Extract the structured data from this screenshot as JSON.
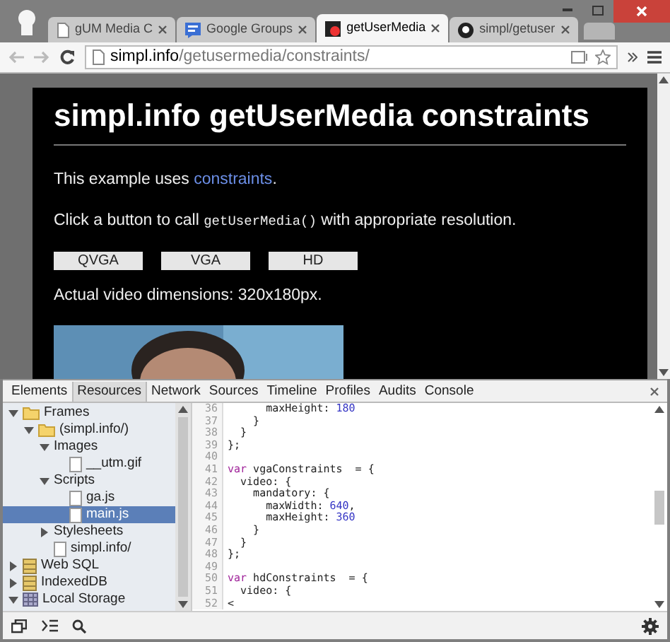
{
  "browser": {
    "tabs": [
      {
        "title": "gUM Media C",
        "kind": "page",
        "selected": false
      },
      {
        "title": "Google Groups",
        "kind": "groups",
        "selected": false
      },
      {
        "title": "getUserMedia",
        "kind": "record",
        "selected": true
      },
      {
        "title": "simpl/getuser",
        "kind": "github",
        "selected": false
      }
    ],
    "url_host": "simpl.info",
    "url_path": "/getusermedia/constraints/"
  },
  "page": {
    "heading": "simpl.info getUserMedia constraints",
    "intro_prefix": "This example uses ",
    "intro_link": "constraints",
    "intro_suffix": ".",
    "instruction_prefix": "Click a button to call ",
    "instruction_code": "getUserMedia()",
    "instruction_suffix": " with appropriate resolution.",
    "buttons": [
      "QVGA",
      "VGA",
      "HD"
    ],
    "dimensions": "Actual video dimensions: 320x180px.",
    "video": {
      "kind": "picture"
    }
  },
  "devtools": {
    "tabs": [
      {
        "label": "Elements",
        "selected": false
      },
      {
        "label": "Resources",
        "selected": true
      },
      {
        "label": "Network",
        "selected": false
      },
      {
        "label": "Sources",
        "selected": false
      },
      {
        "label": "Timeline",
        "selected": false
      },
      {
        "label": "Profiles",
        "selected": false
      },
      {
        "label": "Audits",
        "selected": false
      },
      {
        "label": "Console",
        "selected": false
      }
    ],
    "tree": [
      {
        "label": "Frames",
        "kind": "folder",
        "expanded": true,
        "selected": false,
        "children": [
          {
            "label": "(simpl.info/)",
            "kind": "folder",
            "expanded": true,
            "selected": false,
            "children": [
              {
                "label": "Images",
                "expanded": true,
                "selected": false,
                "children": [
                  {
                    "label": "__utm.gif",
                    "kind": "file",
                    "selected": false
                  }
                ]
              },
              {
                "label": "Scripts",
                "expanded": true,
                "selected": false,
                "children": [
                  {
                    "label": "ga.js",
                    "kind": "file",
                    "selected": false
                  },
                  {
                    "label": "main.js",
                    "kind": "file",
                    "selected": true
                  }
                ]
              },
              {
                "label": "Stylesheets",
                "expanded": false,
                "selected": false
              },
              {
                "label": "simpl.info/",
                "kind": "file",
                "selected": false
              }
            ]
          }
        ]
      },
      {
        "label": "Web SQL",
        "kind": "db",
        "expanded": false,
        "selected": false
      },
      {
        "label": "IndexedDB",
        "kind": "db",
        "expanded": false,
        "selected": false
      },
      {
        "label": "Local Storage",
        "kind": "grid",
        "expanded": true,
        "selected": false
      }
    ],
    "code": [
      {
        "n": "36",
        "tokens": [
          {
            "text": "      maxHeight: ",
            "kind": "plain"
          },
          {
            "text": "180",
            "kind": "number"
          }
        ]
      },
      {
        "n": "37",
        "tokens": [
          {
            "text": "    }",
            "kind": "plain"
          }
        ]
      },
      {
        "n": "38",
        "tokens": [
          {
            "text": "  }",
            "kind": "plain"
          }
        ]
      },
      {
        "n": "39",
        "tokens": [
          {
            "text": "};",
            "kind": "plain"
          }
        ]
      },
      {
        "n": "40"
      },
      {
        "n": "41",
        "tokens": [
          {
            "text": "var",
            "kind": "keyword"
          },
          {
            "text": " vgaConstraints  = {",
            "kind": "plain"
          }
        ]
      },
      {
        "n": "42",
        "tokens": [
          {
            "text": "  video: {",
            "kind": "plain"
          }
        ]
      },
      {
        "n": "43",
        "tokens": [
          {
            "text": "    mandatory: {",
            "kind": "plain"
          }
        ]
      },
      {
        "n": "44",
        "tokens": [
          {
            "text": "      maxWidth: ",
            "kind": "plain"
          },
          {
            "text": "640",
            "kind": "number"
          },
          {
            "text": ",",
            "kind": "plain"
          }
        ]
      },
      {
        "n": "45",
        "tokens": [
          {
            "text": "      maxHeight: ",
            "kind": "plain"
          },
          {
            "text": "360",
            "kind": "number"
          }
        ]
      },
      {
        "n": "46",
        "tokens": [
          {
            "text": "    }",
            "kind": "plain"
          }
        ]
      },
      {
        "n": "47",
        "tokens": [
          {
            "text": "  }",
            "kind": "plain"
          }
        ]
      },
      {
        "n": "48",
        "tokens": [
          {
            "text": "};",
            "kind": "plain"
          }
        ]
      },
      {
        "n": "49"
      },
      {
        "n": "50",
        "tokens": [
          {
            "text": "var",
            "kind": "keyword"
          },
          {
            "text": " hdConstraints  = {",
            "kind": "plain"
          }
        ]
      },
      {
        "n": "51",
        "tokens": [
          {
            "text": "  video: {",
            "kind": "plain"
          }
        ]
      },
      {
        "n": "52",
        "tokens": [
          {
            "text": "<",
            "kind": "plain"
          }
        ]
      }
    ]
  }
}
